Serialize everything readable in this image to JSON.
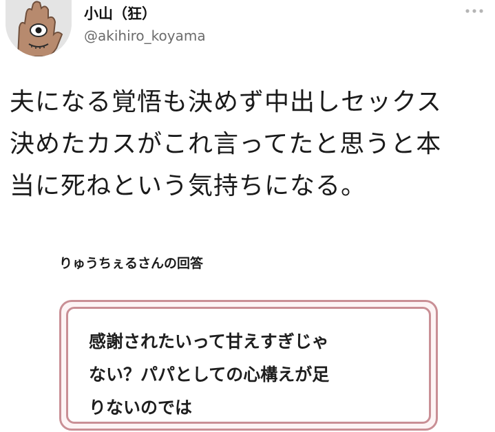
{
  "user": {
    "display_name": "小山（狂）",
    "handle": "@akihiro_koyama"
  },
  "tweet": {
    "lines": [
      "夫になる覚悟も決めず中出しセックス",
      "決めたカスがこれ言ってたと思うと本",
      "当に死ねという気持ちになる。"
    ]
  },
  "quoted_answer": {
    "label": "りゅうちぇるさんの回答",
    "lines": [
      "感謝されたいって甘えすぎじゃ",
      "ない？パパとしての心構えが足",
      "りないのでは"
    ]
  },
  "icons": {
    "more": "more-horizontal-icon",
    "avatar": "hand-eye-avatar"
  },
  "colors": {
    "box_border": "#c98f95",
    "handle": "#6b6b6b"
  }
}
